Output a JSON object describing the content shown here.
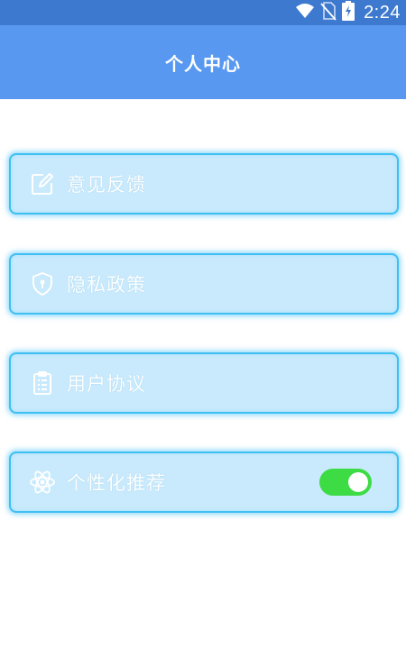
{
  "status_bar": {
    "time": "2:24",
    "icons": [
      "wifi-icon",
      "no-sim-icon",
      "battery-charging-icon"
    ]
  },
  "header": {
    "title": "个人中心"
  },
  "menu": {
    "items": [
      {
        "label": "意见反馈",
        "icon": "edit-icon"
      },
      {
        "label": "隐私政策",
        "icon": "shield-icon"
      },
      {
        "label": "用户协议",
        "icon": "clipboard-icon"
      },
      {
        "label": "个性化推荐",
        "icon": "atom-icon",
        "toggle_on": true
      }
    ]
  },
  "colors": {
    "status_bar": "#3d79cf",
    "title_bar": "#5898f0",
    "card_bg": "#c9eafc",
    "card_border": "#3fbff2",
    "toggle_on": "#3ddc45"
  }
}
